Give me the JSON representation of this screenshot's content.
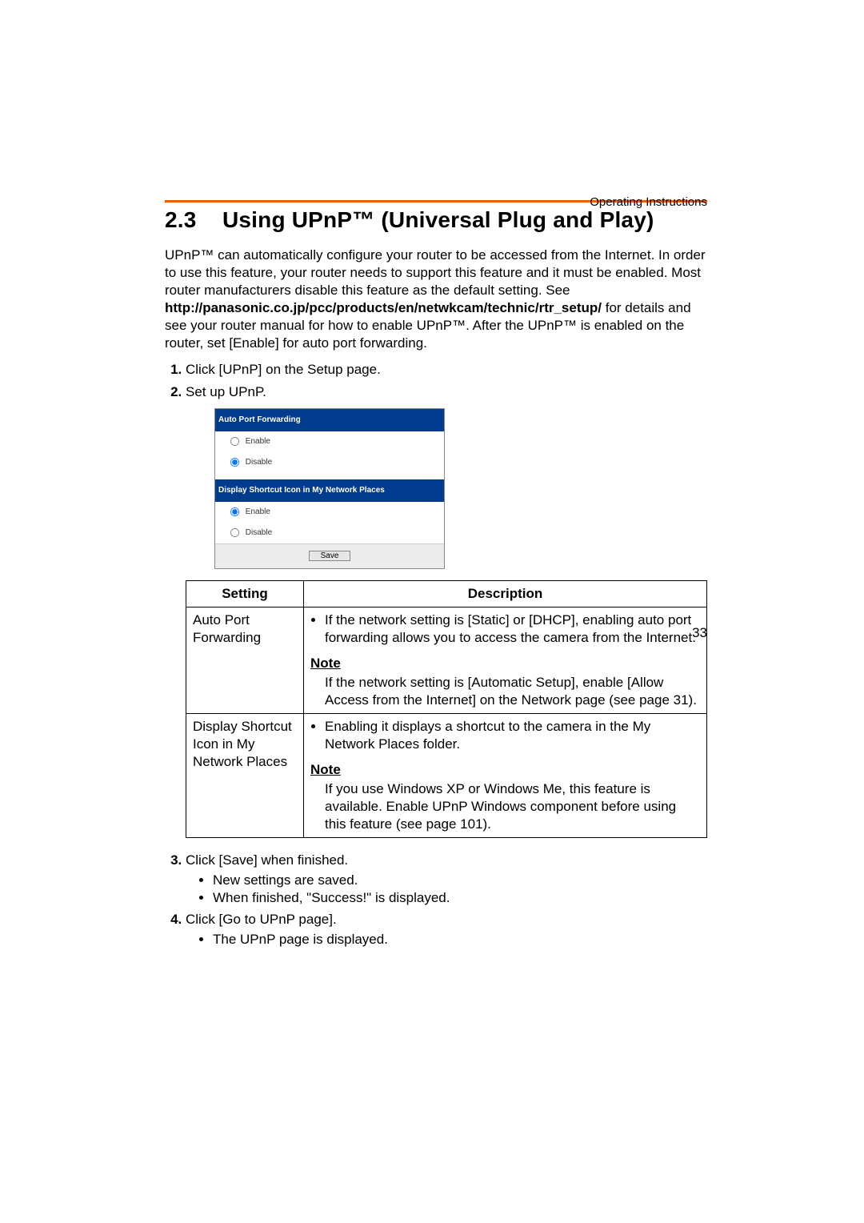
{
  "running_head": "Operating Instructions",
  "section_number": "2.3",
  "section_title": "Using UPnP™ (Universal Plug and Play)",
  "intro_pre": "UPnP™ can automatically configure your router to be accessed from the Internet. In order to use this feature, your router needs to support this feature and it must be enabled. Most router manufacturers disable this feature as the default setting. See ",
  "intro_link": "http://panasonic.co.jp/pcc/products/en/netwkcam/technic/rtr_setup/",
  "intro_post": " for details and see your router manual for how to enable UPnP™. After the UPnP™ is enabled on the router, set [Enable] for auto port forwarding.",
  "steps": {
    "s1": "Click [UPnP] on the Setup page.",
    "s2": "Set up UPnP.",
    "s3": "Click [Save] when finished.",
    "s3_sub1": "New settings are saved.",
    "s3_sub2": "When finished, \"Success!\" is displayed.",
    "s4": "Click [Go to UPnP page].",
    "s4_sub1": "The UPnP page is displayed."
  },
  "mock": {
    "bar1": "Auto Port Forwarding",
    "opt_enable": "Enable",
    "opt_disable": "Disable",
    "bar2": "Display Shortcut Icon in My Network Places",
    "save": "Save"
  },
  "table": {
    "head_setting": "Setting",
    "head_desc": "Description",
    "row1_setting": "Auto Port Forwarding",
    "row1_bullet": "If the network setting is [Static] or [DHCP], enabling auto port forwarding allows you to access the camera from the Internet.",
    "note_label": "Note",
    "row1_note": "If the network setting is [Automatic Setup], enable [Allow Access from the Internet] on the Network page (see page 31).",
    "row2_setting": "Display Shortcut Icon in My Network Places",
    "row2_bullet": "Enabling it displays a shortcut to the camera in the My Network Places folder.",
    "row2_note": "If you use Windows XP or Windows Me, this feature is available. Enable UPnP Windows component before using this feature (see page 101)."
  },
  "page_number": "33"
}
